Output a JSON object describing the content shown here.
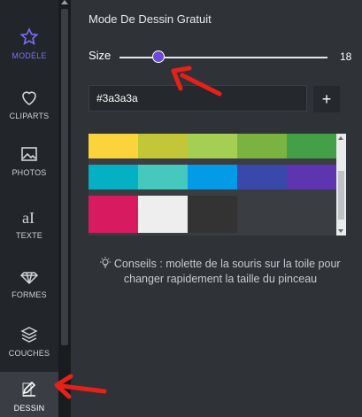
{
  "sidebar": {
    "items": [
      {
        "label": "MODÈLE",
        "icon": "star-icon"
      },
      {
        "label": "CLIPARTS",
        "icon": "heart-icon"
      },
      {
        "label": "PHOTOS",
        "icon": "image-icon"
      },
      {
        "label": "TEXTE",
        "icon": "text-icon"
      },
      {
        "label": "FORMES",
        "icon": "diamond-icon"
      },
      {
        "label": "COUCHES",
        "icon": "layers-icon"
      },
      {
        "label": "DESSIN",
        "icon": "edit-icon"
      }
    ]
  },
  "panel": {
    "title": "Mode De Dessin Gratuit",
    "size_label": "Size",
    "size_value": "18",
    "color_value": "#3a3a3a",
    "add_label": "+",
    "tip": "Conseils : molette de la souris sur la toile pour changer rapidement la taille du pinceau"
  },
  "swatches": [
    "#fbd33b",
    "#c2c637",
    "#a5cf52",
    "#7bb341",
    "#43a047",
    "#04b0c4",
    "#45c9bf",
    "#039be5",
    "#3949ab",
    "#5e35b1",
    "#d81b60",
    "#eeeeee",
    "#333333"
  ],
  "colors": {
    "accent": "#7b6cff",
    "annotation_arrow": "#e8201a",
    "slider_thumb": "#6b4bd6"
  }
}
